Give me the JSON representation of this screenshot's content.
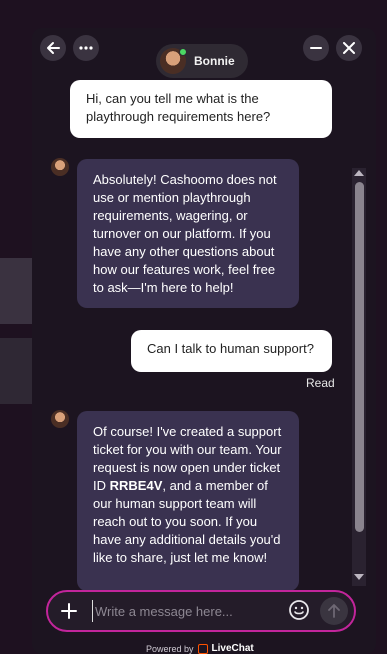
{
  "header": {
    "agent_name": "Bonnie",
    "back_icon": "arrow-left-icon",
    "more_icon": "more-horizontal-icon",
    "minimize_icon": "minimize-icon",
    "close_icon": "close-icon"
  },
  "messages": [
    {
      "from": "user",
      "text": "Hi, can you tell me what is the playthrough requirements here?"
    },
    {
      "from": "agent",
      "text": "Absolutely! Cashoomo does not use or mention playthrough requirements, wagering, or turnover on our platform. If you have any other questions about how our features work, feel free to ask—I'm here to help!"
    },
    {
      "from": "user",
      "text": "Can I talk to human support?",
      "status": "Read"
    },
    {
      "from": "agent",
      "text_before": "Of course! I've created a support ticket for you with our team. Your request is now open under ticket ID ",
      "ticket_id": "RRBE4V",
      "text_after": ", and a member of our human support team will reach out to you soon. If you have any additional details you'd like to share, just let me know!"
    }
  ],
  "composer": {
    "placeholder": "Write a message here...",
    "add_icon": "plus-icon",
    "emoji_icon": "smile-icon",
    "send_icon": "arrow-up-icon"
  },
  "footer": {
    "powered_by": "Powered by",
    "brand": "LiveChat"
  },
  "colors": {
    "accent": "#c2259b",
    "agent_bubble": "#3a3250",
    "online": "#4cd964"
  }
}
